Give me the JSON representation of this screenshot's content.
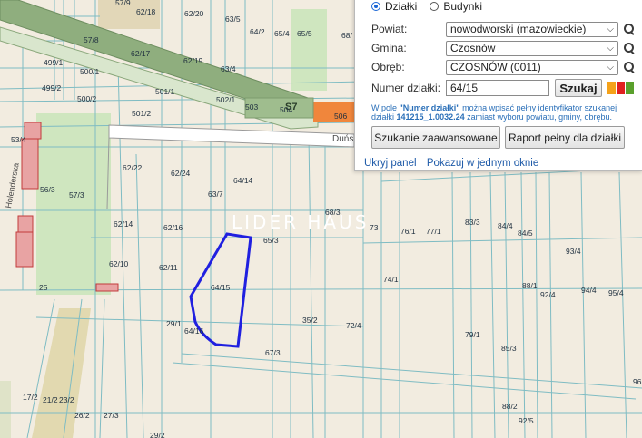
{
  "map": {
    "watermark": "LIDER HAUS",
    "street_name": "Duńs",
    "road_code": "S7",
    "plot_labels": [
      "57/9",
      "62/18",
      "62/20",
      "63/5",
      "64/2",
      "65/4",
      "65/5",
      "68/",
      "57/8",
      "62/17",
      "62/19",
      "63/4",
      "499/1",
      "500/1",
      "499/2",
      "500/2",
      "501/1",
      "502/1",
      "503",
      "504",
      "506",
      "501/2",
      "53/4",
      "56/3",
      "57/3",
      "62/22",
      "62/24",
      "64/14",
      "63/7",
      "68/3",
      "62/14",
      "62/16",
      "65/3",
      "73",
      "76/1",
      "77/1",
      "83/3",
      "84/4",
      "84/5",
      "93/4",
      "62/10",
      "62/11",
      "64/15",
      "25",
      "74/1",
      "88/1",
      "92/4",
      "94/4",
      "95/4",
      "29/1",
      "64/16",
      "35/2",
      "72/4",
      "79/1",
      "67/3",
      "85/3",
      "17/2",
      "21/2",
      "23/2",
      "26/2",
      "27/3",
      "29/2",
      "88/2",
      "92/5",
      "96"
    ],
    "colors": {
      "background": "#f2ece0",
      "parcel_line": "#7fbcc3",
      "highlight": "#2020e0",
      "road_green": "#8fae7e",
      "road_orange": "#f0863c",
      "green_area": "#cfe6bf",
      "building": "#e8a3a3"
    }
  },
  "panel": {
    "search_mode": {
      "options": [
        "Działki",
        "Budynki"
      ],
      "selected": "Działki"
    },
    "powiat": {
      "label": "Powiat:",
      "value": "nowodworski (mazowieckie)"
    },
    "gmina": {
      "label": "Gmina:",
      "value": "Czosnów"
    },
    "obreb": {
      "label": "Obręb:",
      "value": "CZOSNÓW (0011)"
    },
    "numer": {
      "label": "Numer działki:",
      "value": "64/15",
      "button": "Szukaj"
    },
    "help": {
      "part1": "W pole ",
      "field": "\"Numer działki\"",
      "part2": " można wpisać pełny identyfikator szukanej działki ",
      "example": "141215_1.0032.24",
      "part3": " zamiast wyboru powiatu, gminy, obrębu."
    },
    "advanced_button": "Szukanie zaawansowane",
    "report_button": "Raport pełny dla działki",
    "hide_link": "Ukryj panel",
    "window_link": "Pokazuj w jednym oknie",
    "swatches": [
      "#f5a21a",
      "#e02020",
      "#5aa02c"
    ]
  }
}
